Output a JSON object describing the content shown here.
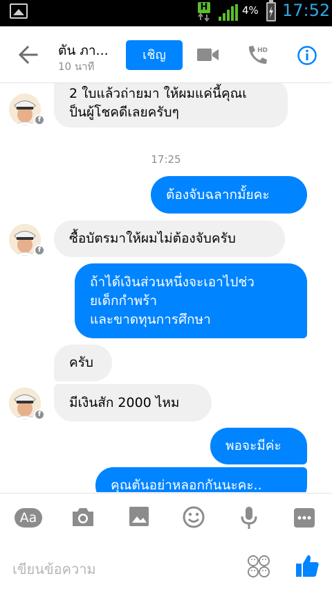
{
  "status_bar": {
    "network_label": "H",
    "battery_percent": "4%",
    "time": "17:52",
    "time_color": "#2ea9e8"
  },
  "header": {
    "title": "ตัน ภา...",
    "subtitle": "10 นาที",
    "invite_label": "เชิญ",
    "icons": [
      "back-arrow-icon",
      "video-call-icon",
      "hd-call-icon",
      "info-icon"
    ],
    "accent_color": "#0084ff"
  },
  "messages": [
    {
      "side": "in",
      "lines": [
        "2 ใบแล้วถ่ายมา ให้ผมแค่นี้คุณเ",
        "ป็นผู้โชคดีเลยครับๆ"
      ],
      "avatar": true
    },
    {
      "type": "time",
      "text": "17:25"
    },
    {
      "side": "out",
      "lines": [
        "ต้องจับฉลากมั้ยคะ"
      ]
    },
    {
      "side": "in",
      "lines": [
        "ซื้อบัตรมาให้ผมไม่ต้องจับครับ"
      ],
      "avatar": true
    },
    {
      "side": "out",
      "lines": [
        "ถ้าได้เงินส่วนหนึ่งจะเอาไปช่ว",
        "ยเด็กกำพร้า",
        "และขาดทุนการศึกษา"
      ]
    },
    {
      "side": "in",
      "lines": [
        "ครับ"
      ],
      "avatar": false
    },
    {
      "side": "in",
      "lines": [
        "มีเงินสัก 2000 ไหม"
      ],
      "avatar": true
    },
    {
      "side": "out",
      "lines": [
        "พอจะมีค่ะ"
      ]
    },
    {
      "side": "out",
      "lines": [
        "คุณตันอย่าหลอกกันนะคะ.."
      ]
    }
  ],
  "toolbar": {
    "aa_label": "Aa",
    "icons": [
      "text-aa-icon",
      "camera-icon",
      "gallery-icon",
      "emoji-icon",
      "microphone-icon",
      "more-icon"
    ]
  },
  "composer": {
    "placeholder": "เขียนข้อความ",
    "icons": [
      "sticker-icon",
      "like-thumb-icon"
    ]
  }
}
